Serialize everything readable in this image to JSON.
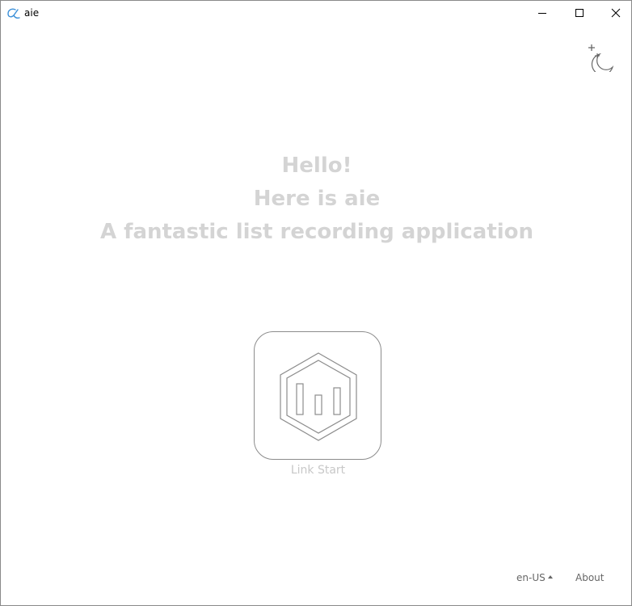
{
  "window": {
    "title": "aie",
    "logo_icon": "alpha-logo-icon",
    "controls": {
      "minimize_icon": "minimize-icon",
      "maximize_icon": "maximize-icon",
      "close_icon": "close-icon"
    }
  },
  "theme_toggle": {
    "icon": "moon-stars-icon"
  },
  "welcome": {
    "line1": "Hello!",
    "line2": "Here is aie",
    "line3": "A fantastic list recording application"
  },
  "start": {
    "icon": "hexagon-bars-icon",
    "label": "Link Start"
  },
  "footer": {
    "language": "en-US",
    "about": "About"
  },
  "colors": {
    "accent": "#3a8fd8",
    "headline": "#d4d4d4",
    "muted_text": "#c8c8c8",
    "footer_text": "#666666",
    "border": "#8c8c8c"
  }
}
